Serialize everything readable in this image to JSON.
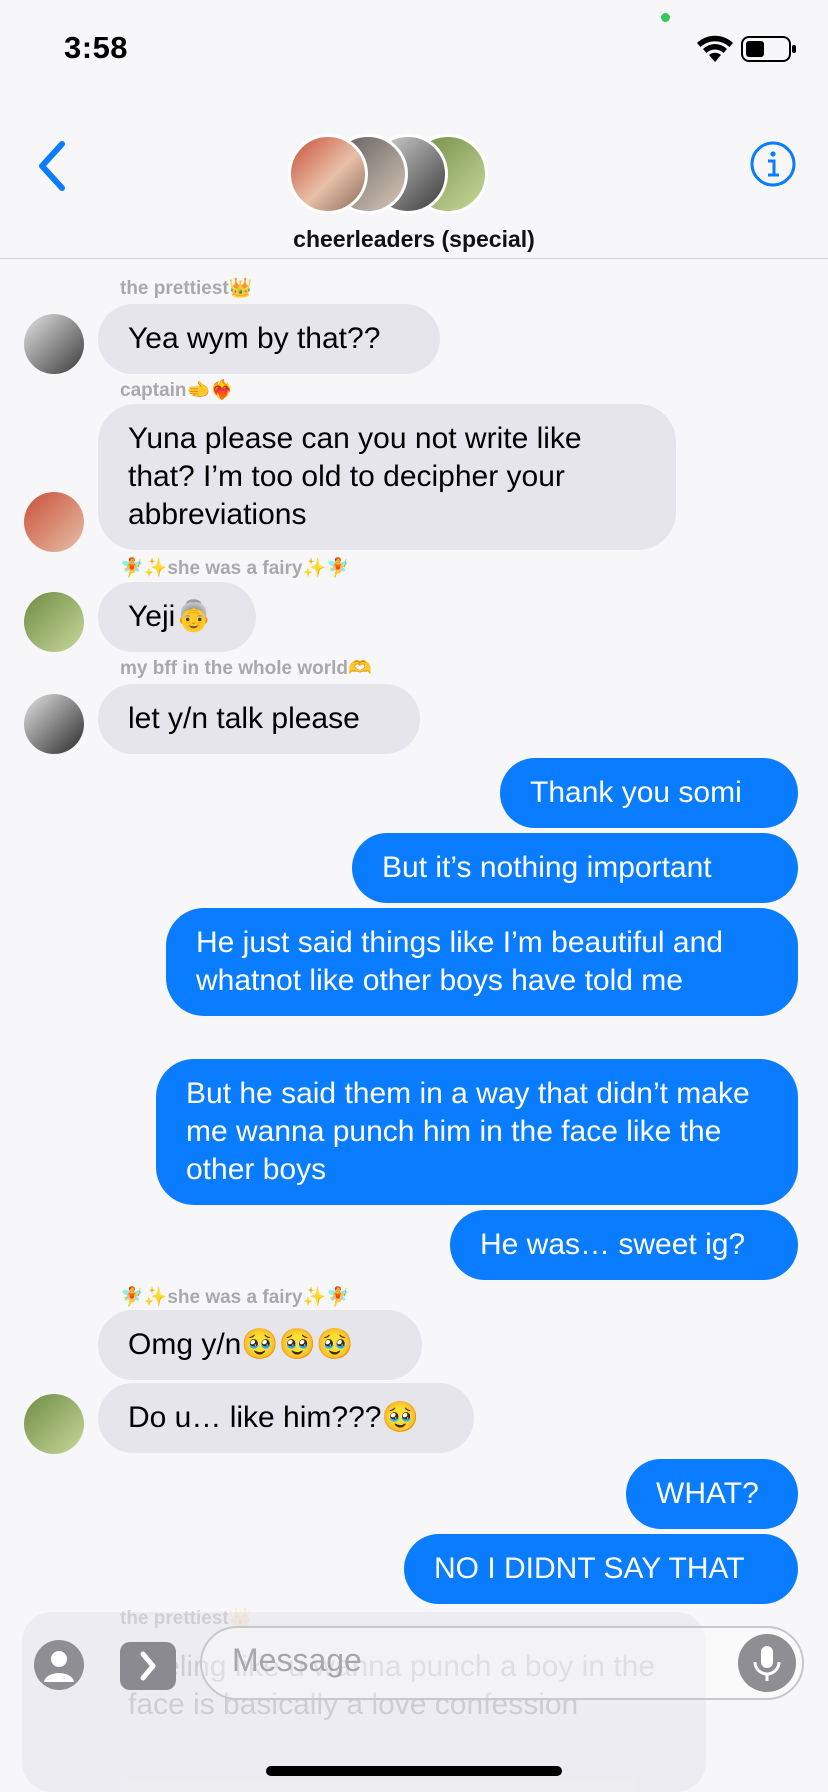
{
  "status": {
    "time": "3:58"
  },
  "header": {
    "group_name": "cheerleaders (special)"
  },
  "messages": [
    {
      "sender": "the prettiest👑",
      "text": "Yea wym by that??"
    },
    {
      "sender": "captain🫲❤️‍🔥",
      "text": "Yuna please can you not write like that? I’m too old to decipher your abbreviations"
    },
    {
      "sender": "🧚✨she was a fairy✨🧚",
      "text": "Yeji👵"
    },
    {
      "sender": "my bff in the whole world🫶",
      "text": "let y/n talk please"
    },
    {
      "text": "Thank you somi"
    },
    {
      "text": "But it’s nothing important"
    },
    {
      "text": "He just said things like I’m beautiful and whatnot like other boys have told me"
    },
    {
      "text": "But he said them in a way that didn’t make me wanna punch him in the face like the other boys"
    },
    {
      "text": "He was… sweet ig?"
    },
    {
      "sender": "🧚✨she was a fairy✨🧚",
      "text": "Omg y/n🥹🥹🥹"
    },
    {
      "text": "Do u… like him???🥹"
    },
    {
      "text": "WHAT?"
    },
    {
      "text": "NO I DIDNT SAY THAT"
    }
  ],
  "composer": {
    "placeholder": "Message",
    "behind_text": "Feeling like u wanna punch a boy in the face is basically a love confession"
  },
  "colors": {
    "outgoing": "#0a7cff",
    "incoming": "#e6e5eb",
    "accent": "#0a7cff"
  }
}
